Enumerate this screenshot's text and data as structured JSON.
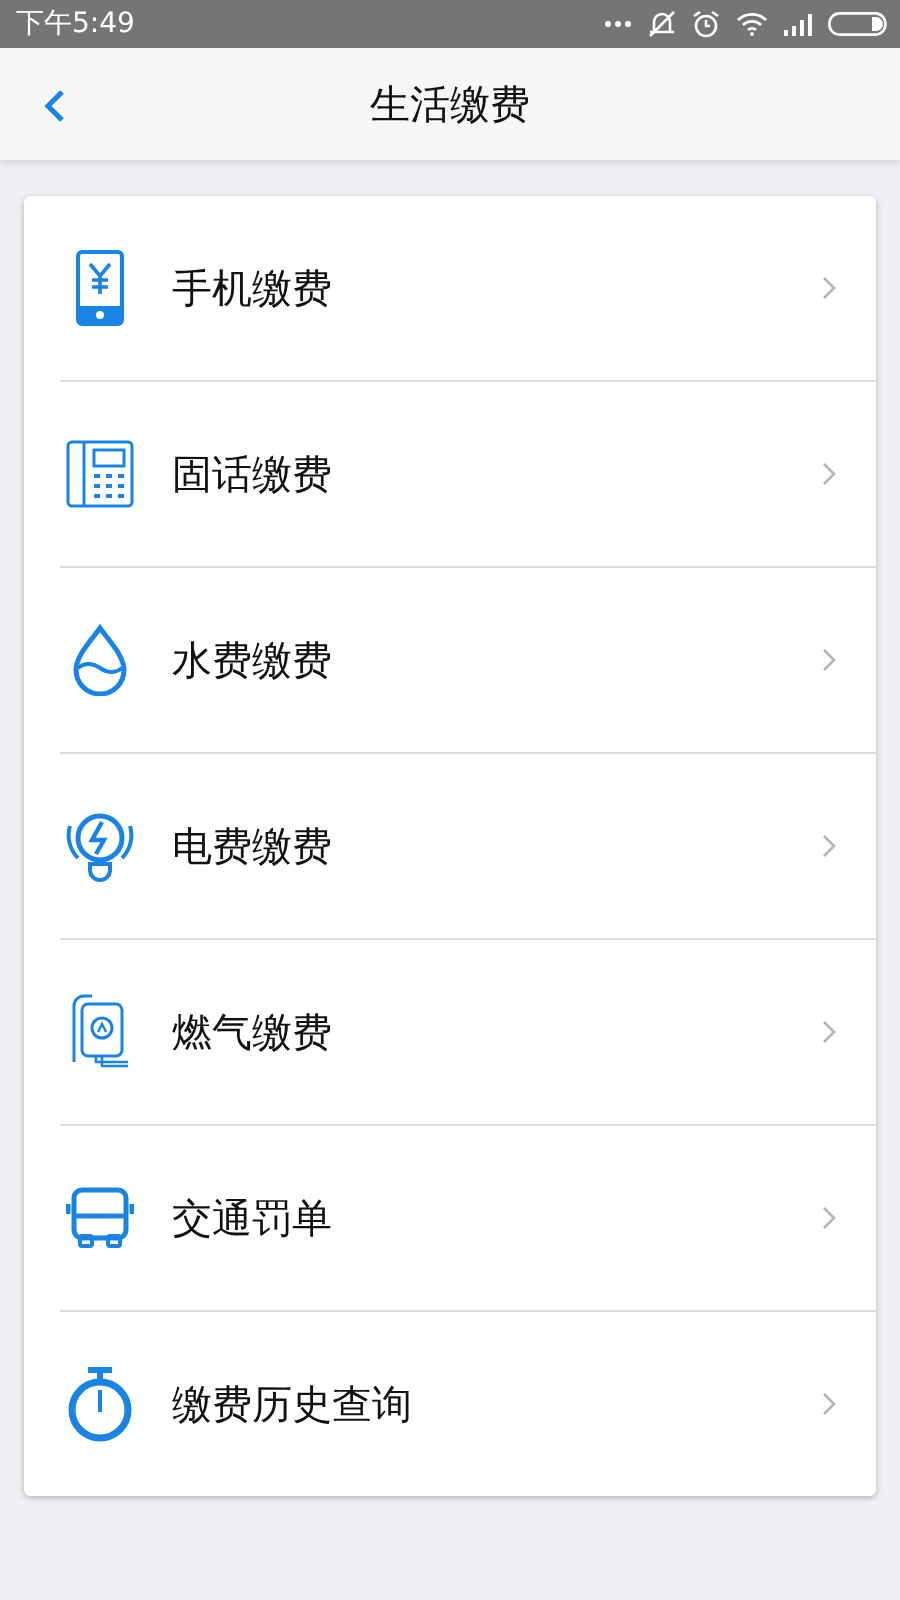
{
  "status_bar": {
    "time": "下午5:49"
  },
  "header": {
    "title": "生活缴费"
  },
  "items": [
    {
      "kind": "phone",
      "label": "手机缴费"
    },
    {
      "kind": "landline",
      "label": "固话缴费"
    },
    {
      "kind": "water",
      "label": "水费缴费"
    },
    {
      "kind": "electric",
      "label": "电费缴费"
    },
    {
      "kind": "gas",
      "label": "燃气缴费"
    },
    {
      "kind": "bus",
      "label": "交通罚单"
    },
    {
      "kind": "timer",
      "label": "缴费历史查询"
    }
  ]
}
